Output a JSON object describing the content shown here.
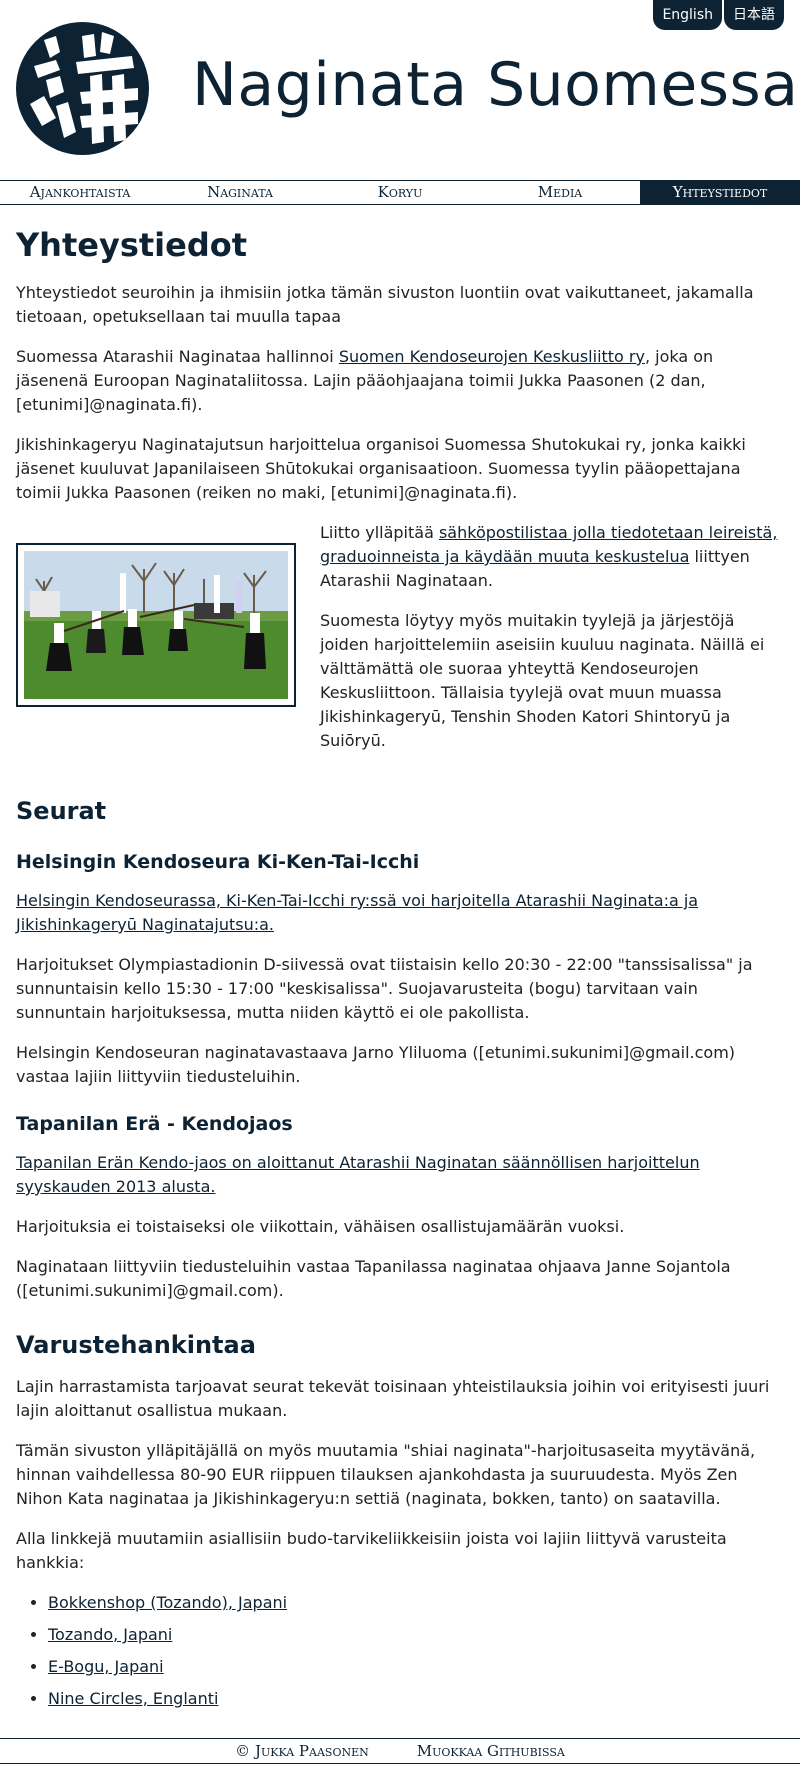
{
  "lang": {
    "english": "English",
    "japanese": "日本語"
  },
  "site": {
    "title": "Naginata Suomessa"
  },
  "nav": {
    "items": [
      {
        "label": "Ajankohtaista"
      },
      {
        "label": "Naginata"
      },
      {
        "label": "Koryu"
      },
      {
        "label": "Media"
      },
      {
        "label": "Yhteystiedot"
      }
    ]
  },
  "page": {
    "title": "Yhteystiedot",
    "intro": "Yhteystiedot seuroihin ja ihmisiin jotka tämän sivuston luontiin ovat vaikuttaneet, jakamalla tietoaan, opetuksellaan tai muulla tapaa",
    "p2_before": "Suomessa Atarashii Naginataa hallinnoi ",
    "p2_link": "Suomen Kendoseurojen Keskusliitto ry",
    "p2_after": ", joka on jäsenenä Euroopan Naginataliitossa. Lajin pääohjaajana toimii Jukka Paasonen (2 dan, [etunimi]@naginata.fi).",
    "p3": "Jikishinkageryu Naginatajutsun harjoittelua organisoi Suomessa Shutokukai ry, jonka kaikki jäsenet kuuluvat Japanilaiseen Shūtokukai organisaatioon. Suomessa tyylin pääopettajana toimii Jukka Paasonen (reiken no maki, [etunimi]@naginata.fi).",
    "p4_before": "Liitto ylläpitää ",
    "p4_link": "sähköpostilistaa jolla tiedotetaan leireistä, graduoinneista ja käydään muuta keskustelua",
    "p4_after": " liittyen Atarashii Naginataan.",
    "p5": "Suomesta löytyy myös muitakin tyylejä ja järjestöjä joiden harjoittelemiin aseisiin kuuluu naginata. Näillä ei välttämättä ole suoraa yhteyttä Kendoseurojen Keskusliittoon. Tällaisia tyylejä ovat muun muassa Jikishinkageryū, Tenshin Shoden Katori Shintoryū ja Suiōryū."
  },
  "clubs": {
    "heading": "Seurat",
    "helsinki": {
      "heading": "Helsingin Kendoseura Ki-Ken-Tai-Icchi",
      "link": "Helsingin Kendoseurassa, Ki-Ken-Tai-Icchi ry:ssä voi harjoitella Atarashii Naginata:a ja Jikishinkageryū Naginatajutsu:a.",
      "p1": "Harjoitukset Olympiastadionin D-siivessä ovat tiistaisin kello 20:30 - 22:00 \"tanssisalissa\" ja sunnuntaisin kello 15:30 - 17:00 \"keskisalissa\". Suojavarusteita (bogu) tarvitaan vain sunnuntain harjoituksessa, mutta niiden käyttö ei ole pakollista.",
      "p2": "Helsingin Kendoseuran naginatavastaava Jarno Yliluoma ([etunimi.sukunimi]@gmail.com) vastaa lajiin liittyviin tiedusteluihin."
    },
    "tapanila": {
      "heading": "Tapanilan Erä - Kendojaos",
      "link": "Tapanilan Erän Kendo-jaos on aloittanut Atarashii Naginatan säännöllisen harjoittelun syyskauden 2013 alusta.",
      "p1": "Harjoituksia ei toistaiseksi ole viikottain, vähäisen osallistujamäärän vuoksi.",
      "p2": "Naginataan liittyviin tiedusteluihin vastaa Tapanilassa naginataa ohjaava Janne Sojantola ([etunimi.sukunimi]@gmail.com)."
    }
  },
  "equipment": {
    "heading": "Varustehankintaa",
    "p1": "Lajin harrastamista tarjoavat seurat tekevät toisinaan yhteistilauksia joihin voi erityisesti juuri lajin aloittanut osallistua mukaan.",
    "p2": "Tämän sivuston ylläpitäjällä on myös muutamia \"shiai naginata\"-harjoitusaseita myytävänä, hinnan vaihdellessa 80-90 EUR riippuen tilauksen ajankohdasta ja suuruudesta. Myös Zen Nihon Kata naginataa ja Jikishinkageryu:n settiä (naginata, bokken, tanto) on saatavilla.",
    "p3": "Alla linkkejä muutamiin asiallisiin budo-tarvikeliikkeisiin joista voi lajiin liittyvä varusteita hankkia:",
    "shops": [
      {
        "label": "Bokkenshop (Tozando), Japani"
      },
      {
        "label": "Tozando, Japani"
      },
      {
        "label": "E-Bogu, Japani"
      },
      {
        "label": "Nine Circles, Englanti"
      }
    ]
  },
  "footer": {
    "copyright": "© Jukka Paasonen",
    "edit": "Muokkaa Githubissa"
  },
  "colors": {
    "brand": "#0d2233",
    "text": "#222222",
    "background": "#ffffff"
  },
  "icons": {
    "logo": "naginata-kanji-logo"
  }
}
